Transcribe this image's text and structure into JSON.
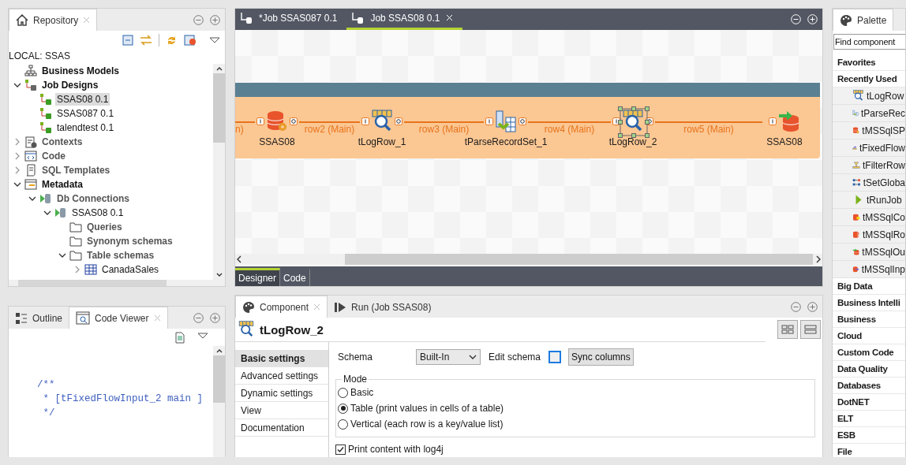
{
  "repository": {
    "tab": "Repository",
    "root": "LOCAL: SSAS",
    "tree": [
      {
        "label": "Business Models",
        "kind": "models",
        "bold": true,
        "greyed": false,
        "selected": false
      },
      {
        "label": "Job Designs",
        "kind": "jobs",
        "bold": true,
        "greyed": false,
        "selected": false,
        "expanded": true,
        "children": [
          {
            "label": "SSAS08 0.1",
            "kind": "job",
            "bold": false,
            "greyed": false,
            "selected": true
          },
          {
            "label": "SSAS087 0.1",
            "kind": "job",
            "bold": false,
            "greyed": false,
            "selected": false
          },
          {
            "label": "talendtest 0.1",
            "kind": "job",
            "bold": false,
            "greyed": false,
            "selected": false
          }
        ]
      },
      {
        "label": "Contexts",
        "kind": "contexts",
        "bold": true,
        "greyed": true,
        "selected": false,
        "expanded": false
      },
      {
        "label": "Code",
        "kind": "code",
        "bold": true,
        "greyed": true,
        "selected": false,
        "expanded": false
      },
      {
        "label": "SQL Templates",
        "kind": "sql",
        "bold": true,
        "greyed": true,
        "selected": false,
        "expanded": false
      },
      {
        "label": "Metadata",
        "kind": "metadata",
        "bold": true,
        "greyed": false,
        "selected": false,
        "expanded": true,
        "children": [
          {
            "label": "Db Connections",
            "kind": "db",
            "bold": true,
            "greyed": true,
            "selected": false,
            "expanded": true,
            "children": [
              {
                "label": "SSAS08 0.1",
                "kind": "db",
                "bold": false,
                "greyed": false,
                "selected": false,
                "expanded": true,
                "children": [
                  {
                    "label": "Queries",
                    "kind": "folder",
                    "bold": true,
                    "greyed": true,
                    "selected": false
                  },
                  {
                    "label": "Synonym schemas",
                    "kind": "folder",
                    "bold": true,
                    "greyed": true,
                    "selected": false
                  },
                  {
                    "label": "Table schemas",
                    "kind": "folder",
                    "bold": true,
                    "greyed": true,
                    "selected": false,
                    "expanded": true,
                    "children": [
                      {
                        "label": "CanadaSales",
                        "kind": "table",
                        "bold": false,
                        "greyed": false,
                        "selected": false,
                        "expanded": false
                      }
                    ]
                  }
                ]
              }
            ]
          }
        ]
      }
    ]
  },
  "code_viewer": {
    "tabs": [
      {
        "label": "Outline",
        "kind": "outline",
        "selected": false
      },
      {
        "label": "Code Viewer",
        "kind": "viewer",
        "selected": true
      }
    ],
    "lines": [
      "/**",
      " * [tFixedFlowInput_2 main ]",
      " */"
    ]
  },
  "editor": {
    "tabs": [
      {
        "label": "*Job SSAS087 0.1",
        "selected": false
      },
      {
        "label": "Job SSAS08 0.1",
        "selected": true
      }
    ],
    "nodes": [
      {
        "label": "SSAS08",
        "kind": "db-sp",
        "selected": false
      },
      {
        "label": "tLogRow_1",
        "kind": "log",
        "selected": false
      },
      {
        "label": "tParseRecordSet_1",
        "kind": "parse",
        "selected": false
      },
      {
        "label": "tLogRow_2",
        "kind": "log",
        "selected": true
      },
      {
        "label": "SSAS08",
        "kind": "db-out",
        "selected": false
      }
    ],
    "links": [
      "n)",
      "row2 (Main)",
      "row3 (Main)",
      "row4 (Main)",
      "row5 (Main)"
    ],
    "view_tabs": [
      {
        "label": "Designer",
        "selected": true
      },
      {
        "label": "Code",
        "selected": false
      }
    ]
  },
  "component": {
    "tabs": [
      {
        "label": "Component",
        "kind": "component",
        "selected": true
      },
      {
        "label": "Run (Job SSAS08)",
        "kind": "run",
        "selected": false
      }
    ],
    "title": "tLogRow_2",
    "menu": [
      {
        "label": "Basic settings",
        "selected": true
      },
      {
        "label": "Advanced settings",
        "selected": false
      },
      {
        "label": "Dynamic settings",
        "selected": false
      },
      {
        "label": "View",
        "selected": false
      },
      {
        "label": "Documentation",
        "selected": false
      }
    ],
    "schema": {
      "label": "Schema",
      "value": "Built-In",
      "edit_label": "Edit schema",
      "sync_button": "Sync columns"
    },
    "mode": {
      "legend": "Mode",
      "options": [
        {
          "label": "Basic",
          "selected": false
        },
        {
          "label": "Table (print values in cells of a table)",
          "selected": true
        },
        {
          "label": "Vertical (each row is a key/value list)",
          "selected": false
        }
      ]
    },
    "log4j": {
      "label": "Print content with log4j",
      "checked": true
    }
  },
  "palette": {
    "tab": "Palette",
    "search": {
      "placeholder": "Find component"
    },
    "groups": [
      {
        "label": "Favorites"
      },
      {
        "label": "Recently Used",
        "items": [
          {
            "label": "tLogRow",
            "kind": "log"
          },
          {
            "label": "tParseRec",
            "kind": "parse"
          },
          {
            "label": "tMSSqlSP",
            "kind": "db-sp"
          },
          {
            "label": "tFixedFlow",
            "kind": "fixed"
          },
          {
            "label": "tFilterRow",
            "kind": "filter"
          },
          {
            "label": "tSetGloba",
            "kind": "setglobal"
          },
          {
            "label": "tRunJob",
            "kind": "run"
          },
          {
            "label": "tMSSqlCo",
            "kind": "db-conn"
          },
          {
            "label": "tMSSqlRo",
            "kind": "db-row"
          },
          {
            "label": "tMSSqlOu",
            "kind": "db-out"
          },
          {
            "label": "tMSSqlInp",
            "kind": "db-in"
          }
        ]
      },
      {
        "label": "Big Data"
      },
      {
        "label": "Business Intelli"
      },
      {
        "label": "Business"
      },
      {
        "label": "Cloud"
      },
      {
        "label": "Custom Code"
      },
      {
        "label": "Data Quality"
      },
      {
        "label": "Databases"
      },
      {
        "label": "DotNET"
      },
      {
        "label": "ELT"
      },
      {
        "label": "ESB"
      },
      {
        "label": "File"
      }
    ]
  }
}
